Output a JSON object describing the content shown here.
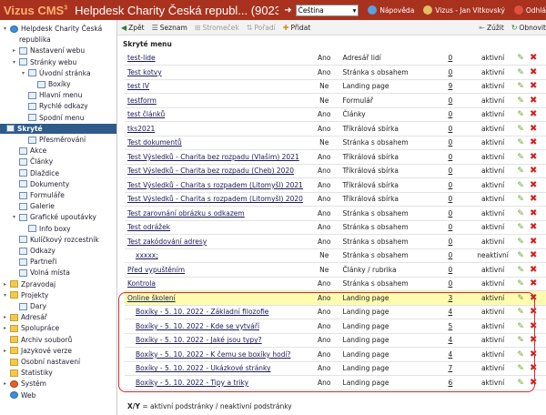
{
  "topbar": {
    "brand": "Vizus CMS",
    "brand_sup": "3",
    "title": "Helpdesk Charity Česká republ... (9023)",
    "language": "Čeština",
    "help": "Nápověda",
    "user": "Vizus - Jan Vitkovský",
    "logout": "Odhlá"
  },
  "colors": {
    "topbar": "#a8321e",
    "selected": "#2e5b8a",
    "highlight": "#fffcb0",
    "bracket": "#d32a2a"
  },
  "sidebar": [
    {
      "label": "Helpdesk Charity Česká",
      "icon": "globe",
      "indent": 0,
      "exp": "▾"
    },
    {
      "label": "republika",
      "icon": "",
      "indent": 1,
      "exp": ""
    },
    {
      "label": "Nastavení webu",
      "icon": "page",
      "indent": 1,
      "exp": "▸"
    },
    {
      "label": "Stránky webu",
      "icon": "page",
      "indent": 1,
      "exp": "▾"
    },
    {
      "label": "Úvodní stránka",
      "icon": "page",
      "indent": 2,
      "exp": "▾"
    },
    {
      "label": "Boxíky",
      "icon": "page",
      "indent": 3,
      "exp": ""
    },
    {
      "label": "Hlavní menu",
      "icon": "page",
      "indent": 2,
      "exp": ""
    },
    {
      "label": "Rychlé odkazy",
      "icon": "page",
      "indent": 2,
      "exp": ""
    },
    {
      "label": "Spodní menu",
      "icon": "page",
      "indent": 2,
      "exp": ""
    },
    {
      "label": "Skryté",
      "icon": "page",
      "indent": 2,
      "exp": "",
      "selected": true
    },
    {
      "label": "Přesměrování",
      "icon": "page",
      "indent": 2,
      "exp": ""
    },
    {
      "label": "Akce",
      "icon": "page",
      "indent": 1,
      "exp": ""
    },
    {
      "label": "Články",
      "icon": "page",
      "indent": 1,
      "exp": ""
    },
    {
      "label": "Dlaždice",
      "icon": "page",
      "indent": 1,
      "exp": ""
    },
    {
      "label": "Dokumenty",
      "icon": "page",
      "indent": 1,
      "exp": ""
    },
    {
      "label": "Formuláře",
      "icon": "page",
      "indent": 1,
      "exp": ""
    },
    {
      "label": "Galerie",
      "icon": "page",
      "indent": 1,
      "exp": ""
    },
    {
      "label": "Grafické upoutávky",
      "icon": "page",
      "indent": 1,
      "exp": "▾"
    },
    {
      "label": "Info boxy",
      "icon": "page",
      "indent": 2,
      "exp": ""
    },
    {
      "label": "Kulíčkový rozcestník",
      "icon": "page",
      "indent": 1,
      "exp": ""
    },
    {
      "label": "Odkazy",
      "icon": "page",
      "indent": 1,
      "exp": ""
    },
    {
      "label": "Partneři",
      "icon": "page",
      "indent": 1,
      "exp": ""
    },
    {
      "label": "Volná místa",
      "icon": "page",
      "indent": 1,
      "exp": ""
    },
    {
      "label": "Zpravodaj",
      "icon": "folder",
      "indent": 0,
      "exp": "▸"
    },
    {
      "label": "Projekty",
      "icon": "folder",
      "indent": 0,
      "exp": "▾"
    },
    {
      "label": "Dary",
      "icon": "page",
      "indent": 1,
      "exp": ""
    },
    {
      "label": "Adresář",
      "icon": "folder",
      "indent": 0,
      "exp": "▸"
    },
    {
      "label": "Spolupráce",
      "icon": "folder",
      "indent": 0,
      "exp": "▸"
    },
    {
      "label": "Archiv souborů",
      "icon": "folder",
      "indent": 0,
      "exp": ""
    },
    {
      "label": "Jazykové verze",
      "icon": "folder",
      "indent": 0,
      "exp": "▸"
    },
    {
      "label": "Osobní nastavení",
      "icon": "folder",
      "indent": 0,
      "exp": ""
    },
    {
      "label": "Statistiky",
      "icon": "folder",
      "indent": 0,
      "exp": ""
    },
    {
      "label": "Systém",
      "icon": "red",
      "indent": 0,
      "exp": "▸"
    },
    {
      "label": "Web",
      "icon": "globe",
      "indent": 0,
      "exp": ""
    }
  ],
  "toolbar": {
    "back": "Zpět",
    "list": "Seznam",
    "tree": "Stromeček",
    "order": "Pořadí",
    "add": "Přidat",
    "narrow": "Zúžit",
    "refresh": "Obnovit"
  },
  "section_title": "Skryté menu",
  "rows": [
    {
      "name": "test-lide",
      "ano": "Ano",
      "type": "Adresář lidí",
      "count": "0",
      "state": "aktivní"
    },
    {
      "name": "Test kotvy",
      "ano": "Ano",
      "type": "Stránka s obsahem",
      "count": "0",
      "state": "aktivní"
    },
    {
      "name": "test lV",
      "ano": "Ne",
      "type": "Landing page",
      "count": "9",
      "state": "aktivní"
    },
    {
      "name": "testform",
      "ano": "Ne",
      "type": "Formulář",
      "count": "0",
      "state": "aktivní"
    },
    {
      "name": "test článků",
      "ano": "Ano",
      "type": "Články",
      "count": "0",
      "state": "aktivní"
    },
    {
      "name": "tks2021",
      "ano": "Ano",
      "type": "Tříkrálová sbírka",
      "count": "0",
      "state": "aktivní"
    },
    {
      "name": "Test dokumentů",
      "ano": "Ne",
      "type": "Stránka s obsahem",
      "count": "0",
      "state": "aktivní"
    },
    {
      "name": "Test Výsledků - Charita bez rozpadu (Vlašim) 2021",
      "ano": "Ano",
      "type": "Tříkrálová sbírka",
      "count": "0",
      "state": "aktivní"
    },
    {
      "name": "Test Výsledků - Charita bez rozpadu (Cheb) 2020",
      "ano": "Ano",
      "type": "Tříkrálová sbírka",
      "count": "0",
      "state": "aktivní"
    },
    {
      "name": "Test Výsledků - Charita s rozpadem (Litomyšl) 2021",
      "ano": "Ano",
      "type": "Tříkrálová sbírka",
      "count": "0",
      "state": "aktivní"
    },
    {
      "name": "Test Výsledků - Charita s rozpadem (Litomyšl) 2020",
      "ano": "Ano",
      "type": "Tříkrálová sbírka",
      "count": "0",
      "state": "aktivní"
    },
    {
      "name": "Test zarovnání obrázku s odkazem",
      "ano": "Ano",
      "type": "Stránka s obsahem",
      "count": "0",
      "state": "aktivní"
    },
    {
      "name": "Test odrážek",
      "ano": "Ano",
      "type": "Stránka s obsahem",
      "count": "0",
      "state": "aktivní"
    },
    {
      "name": "Test zakódování adresy",
      "ano": "Ano",
      "type": "Stránka s obsahem",
      "count": "0",
      "state": "aktivní"
    },
    {
      "name": "xxxxx;",
      "ano": "Ne",
      "type": "Stránka s obsahem",
      "count": "0",
      "state": "neaktivní",
      "indent": true
    },
    {
      "name": "Před vypuštěním",
      "ano": "Ne",
      "type": "Články / rubrika",
      "count": "0",
      "state": "aktivní"
    },
    {
      "name": "Kontrola",
      "ano": "Ano",
      "type": "Stránka s obsahem",
      "count": "0",
      "state": "aktivní"
    },
    {
      "name": "Online školení",
      "ano": "Ano",
      "type": "Landing page",
      "count": "3",
      "state": "aktivní",
      "highlight": true
    },
    {
      "name": "Boxíky - 5. 10. 2022 - Základní filozofie",
      "ano": "Ano",
      "type": "Landing page",
      "count": "4",
      "state": "aktivní",
      "indent": true
    },
    {
      "name": "Boxíky - 5. 10. 2022 - Kde se vytváří",
      "ano": "Ano",
      "type": "Landing page",
      "count": "5",
      "state": "aktivní",
      "indent": true
    },
    {
      "name": "Boxíky - 5. 10. 2022 - Jaké jsou typy?",
      "ano": "Ano",
      "type": "Landing page",
      "count": "4",
      "state": "aktivní",
      "indent": true
    },
    {
      "name": "Boxíky - 5. 10. 2022 - K čemu se boxíky hodí?",
      "ano": "Ano",
      "type": "Landing page",
      "count": "4",
      "state": "aktivní",
      "indent": true
    },
    {
      "name": "Boxíky - 5. 10. 2022 - Ukázkové stránky",
      "ano": "Ano",
      "type": "Landing page",
      "count": "7",
      "state": "aktivní",
      "indent": true
    },
    {
      "name": "Boxíky - 5. 10. 2022 - Tipy a triky",
      "ano": "Ano",
      "type": "Landing page",
      "count": "6",
      "state": "aktivní",
      "indent": true
    }
  ],
  "footnote": {
    "bold": "X/Y",
    "text": " = aktivní podstránky / neaktivní podstránky"
  }
}
